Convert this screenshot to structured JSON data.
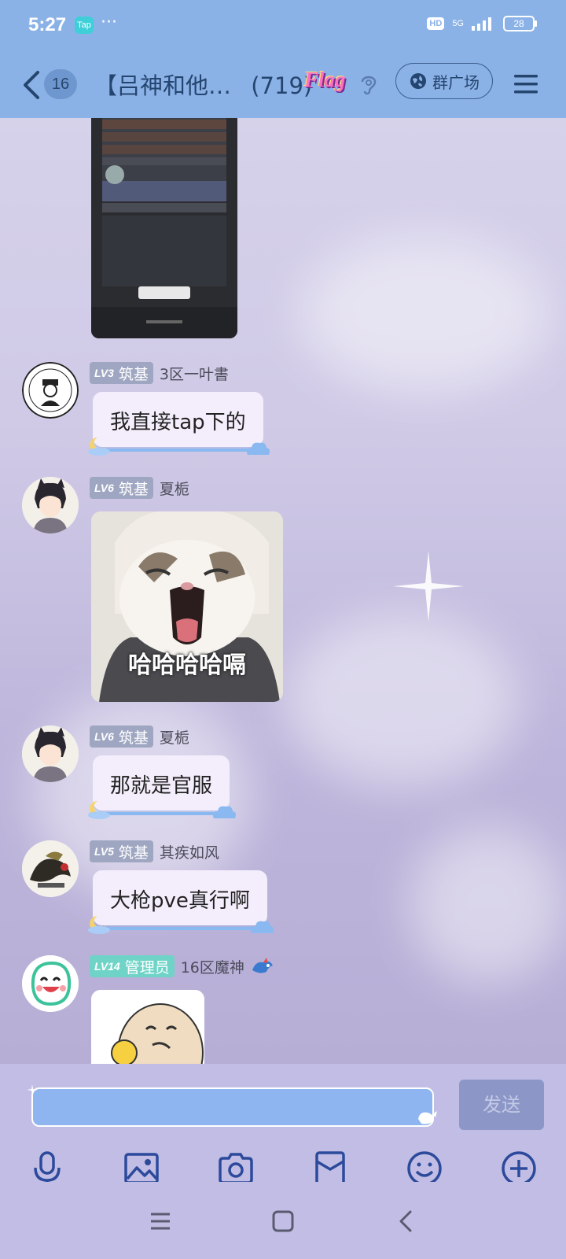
{
  "status_bar": {
    "time": "5:27",
    "app_badge": "Tap",
    "more_dots": "···",
    "hd": "HD",
    "network": "5G",
    "battery": "28"
  },
  "header": {
    "unread_count": "16",
    "group_title": "【吕神和他…",
    "member_count": "(719)",
    "flag_text": "Flag",
    "square_button": "群广场"
  },
  "messages": [
    {
      "level": "LV3",
      "title": "筑基",
      "nickname": "3区一叶書",
      "text": "我直接tap下的"
    },
    {
      "level": "LV6",
      "title": "筑基",
      "nickname": "夏栀",
      "sticker_caption": "哈哈哈哈嗝"
    },
    {
      "level": "LV6",
      "title": "筑基",
      "nickname": "夏栀",
      "text": "那就是官服"
    },
    {
      "level": "LV5",
      "title": "筑基",
      "nickname": "其疾如风",
      "text": "大枪pve真行啊"
    },
    {
      "level": "LV14",
      "title": "管理员",
      "nickname": "16区魔神"
    }
  ],
  "input_bar": {
    "send_label": "发送",
    "tools": [
      "microphone-icon",
      "image-icon",
      "camera-icon",
      "red-packet-icon",
      "emoji-icon",
      "plus-icon"
    ]
  },
  "colors": {
    "header_bg": "#8bb2e6",
    "bubble_bg": "#f4eefc",
    "level_badge": "#9ea6c1",
    "admin_badge": "#6fd4c7",
    "send_button": "#8c97c7"
  }
}
